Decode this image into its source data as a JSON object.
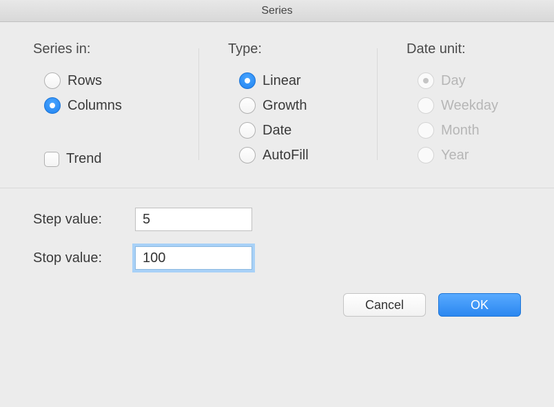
{
  "title": "Series",
  "series_in": {
    "label": "Series in:",
    "rows": "Rows",
    "columns": "Columns",
    "trend": "Trend",
    "selected": "columns",
    "trend_checked": false
  },
  "type": {
    "label": "Type:",
    "linear": "Linear",
    "growth": "Growth",
    "date": "Date",
    "autofill": "AutoFill",
    "selected": "linear"
  },
  "date_unit": {
    "label": "Date unit:",
    "day": "Day",
    "weekday": "Weekday",
    "month": "Month",
    "year": "Year",
    "selected": "day",
    "enabled": false
  },
  "inputs": {
    "step_label": "Step value:",
    "step_value": "5",
    "stop_label": "Stop value:",
    "stop_value": "100"
  },
  "buttons": {
    "cancel": "Cancel",
    "ok": "OK"
  }
}
